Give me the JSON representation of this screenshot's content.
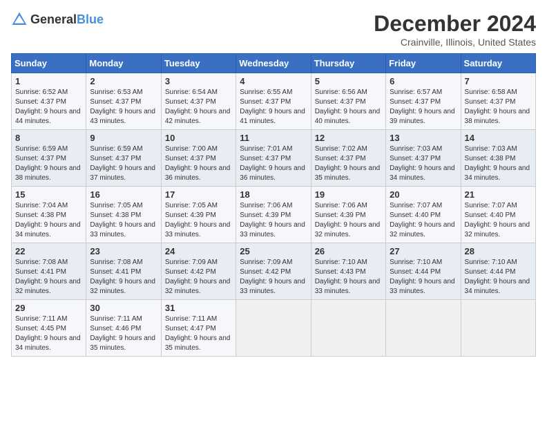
{
  "header": {
    "logo_general": "General",
    "logo_blue": "Blue",
    "month_title": "December 2024",
    "location": "Crainville, Illinois, United States"
  },
  "weekdays": [
    "Sunday",
    "Monday",
    "Tuesday",
    "Wednesday",
    "Thursday",
    "Friday",
    "Saturday"
  ],
  "weeks": [
    [
      {
        "day": "1",
        "sunrise": "6:52 AM",
        "sunset": "4:37 PM",
        "daylight": "9 hours and 44 minutes."
      },
      {
        "day": "2",
        "sunrise": "6:53 AM",
        "sunset": "4:37 PM",
        "daylight": "9 hours and 43 minutes."
      },
      {
        "day": "3",
        "sunrise": "6:54 AM",
        "sunset": "4:37 PM",
        "daylight": "9 hours and 42 minutes."
      },
      {
        "day": "4",
        "sunrise": "6:55 AM",
        "sunset": "4:37 PM",
        "daylight": "9 hours and 41 minutes."
      },
      {
        "day": "5",
        "sunrise": "6:56 AM",
        "sunset": "4:37 PM",
        "daylight": "9 hours and 40 minutes."
      },
      {
        "day": "6",
        "sunrise": "6:57 AM",
        "sunset": "4:37 PM",
        "daylight": "9 hours and 39 minutes."
      },
      {
        "day": "7",
        "sunrise": "6:58 AM",
        "sunset": "4:37 PM",
        "daylight": "9 hours and 38 minutes."
      }
    ],
    [
      {
        "day": "8",
        "sunrise": "6:59 AM",
        "sunset": "4:37 PM",
        "daylight": "9 hours and 38 minutes."
      },
      {
        "day": "9",
        "sunrise": "6:59 AM",
        "sunset": "4:37 PM",
        "daylight": "9 hours and 37 minutes."
      },
      {
        "day": "10",
        "sunrise": "7:00 AM",
        "sunset": "4:37 PM",
        "daylight": "9 hours and 36 minutes."
      },
      {
        "day": "11",
        "sunrise": "7:01 AM",
        "sunset": "4:37 PM",
        "daylight": "9 hours and 36 minutes."
      },
      {
        "day": "12",
        "sunrise": "7:02 AM",
        "sunset": "4:37 PM",
        "daylight": "9 hours and 35 minutes."
      },
      {
        "day": "13",
        "sunrise": "7:03 AM",
        "sunset": "4:37 PM",
        "daylight": "9 hours and 34 minutes."
      },
      {
        "day": "14",
        "sunrise": "7:03 AM",
        "sunset": "4:38 PM",
        "daylight": "9 hours and 34 minutes."
      }
    ],
    [
      {
        "day": "15",
        "sunrise": "7:04 AM",
        "sunset": "4:38 PM",
        "daylight": "9 hours and 34 minutes."
      },
      {
        "day": "16",
        "sunrise": "7:05 AM",
        "sunset": "4:38 PM",
        "daylight": "9 hours and 33 minutes."
      },
      {
        "day": "17",
        "sunrise": "7:05 AM",
        "sunset": "4:39 PM",
        "daylight": "9 hours and 33 minutes."
      },
      {
        "day": "18",
        "sunrise": "7:06 AM",
        "sunset": "4:39 PM",
        "daylight": "9 hours and 33 minutes."
      },
      {
        "day": "19",
        "sunrise": "7:06 AM",
        "sunset": "4:39 PM",
        "daylight": "9 hours and 32 minutes."
      },
      {
        "day": "20",
        "sunrise": "7:07 AM",
        "sunset": "4:40 PM",
        "daylight": "9 hours and 32 minutes."
      },
      {
        "day": "21",
        "sunrise": "7:07 AM",
        "sunset": "4:40 PM",
        "daylight": "9 hours and 32 minutes."
      }
    ],
    [
      {
        "day": "22",
        "sunrise": "7:08 AM",
        "sunset": "4:41 PM",
        "daylight": "9 hours and 32 minutes."
      },
      {
        "day": "23",
        "sunrise": "7:08 AM",
        "sunset": "4:41 PM",
        "daylight": "9 hours and 32 minutes."
      },
      {
        "day": "24",
        "sunrise": "7:09 AM",
        "sunset": "4:42 PM",
        "daylight": "9 hours and 32 minutes."
      },
      {
        "day": "25",
        "sunrise": "7:09 AM",
        "sunset": "4:42 PM",
        "daylight": "9 hours and 33 minutes."
      },
      {
        "day": "26",
        "sunrise": "7:10 AM",
        "sunset": "4:43 PM",
        "daylight": "9 hours and 33 minutes."
      },
      {
        "day": "27",
        "sunrise": "7:10 AM",
        "sunset": "4:44 PM",
        "daylight": "9 hours and 33 minutes."
      },
      {
        "day": "28",
        "sunrise": "7:10 AM",
        "sunset": "4:44 PM",
        "daylight": "9 hours and 34 minutes."
      }
    ],
    [
      {
        "day": "29",
        "sunrise": "7:11 AM",
        "sunset": "4:45 PM",
        "daylight": "9 hours and 34 minutes."
      },
      {
        "day": "30",
        "sunrise": "7:11 AM",
        "sunset": "4:46 PM",
        "daylight": "9 hours and 35 minutes."
      },
      {
        "day": "31",
        "sunrise": "7:11 AM",
        "sunset": "4:47 PM",
        "daylight": "9 hours and 35 minutes."
      },
      null,
      null,
      null,
      null
    ]
  ]
}
